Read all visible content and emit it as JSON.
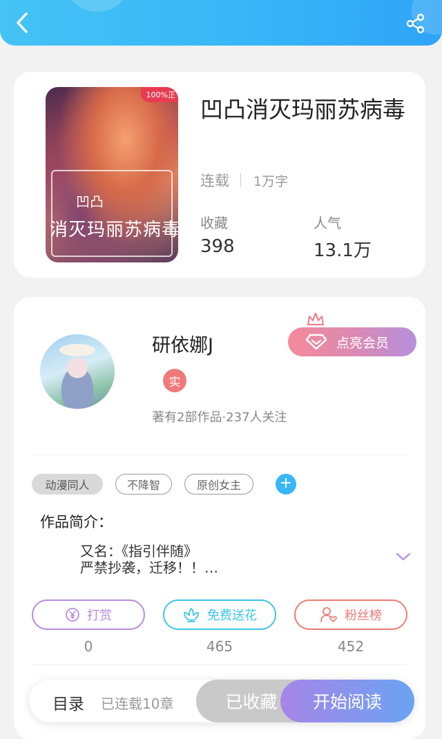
{
  "header": {
    "back_icon": "chevron-left-icon",
    "share_icon": "share-icon"
  },
  "book": {
    "title": "凹凸消灭玛丽苏病毒",
    "status": "连载",
    "word_count": "1万字",
    "cover": {
      "badge": "100%正",
      "title_line1": "凹凸",
      "title_line2": "消灭玛丽苏病毒"
    },
    "stats": {
      "collect_label": "收藏",
      "collect_value": "398",
      "popularity_label": "人气",
      "popularity_value": "13.1万"
    }
  },
  "author": {
    "name": "研依娜J",
    "verified_badge": "实",
    "meta": "著有2部作品·237人关注",
    "vip_button": "点亮会员"
  },
  "tags": [
    "动漫同人",
    "不降智",
    "原创女主"
  ],
  "intro": {
    "label": "作品简介：",
    "line1": "又名：《指引伴随》",
    "line2": "严禁抄袭，迁移！！…"
  },
  "actions": {
    "reward_label": "打赏",
    "reward_count": "0",
    "flower_label": "免费送花",
    "flower_count": "465",
    "fans_label": "粉丝榜",
    "fans_count": "452"
  },
  "bottom": {
    "toc_label": "目录",
    "toc_status": "已连载10章",
    "collected_label": "已收藏",
    "read_label": "开始阅读"
  },
  "colors": {
    "header_blue": "#38b6f7",
    "accent_purple": "#b58fde",
    "accent_cyan": "#3cc6e8",
    "accent_red": "#ef7b73",
    "reward_purple": "#b88be0"
  }
}
